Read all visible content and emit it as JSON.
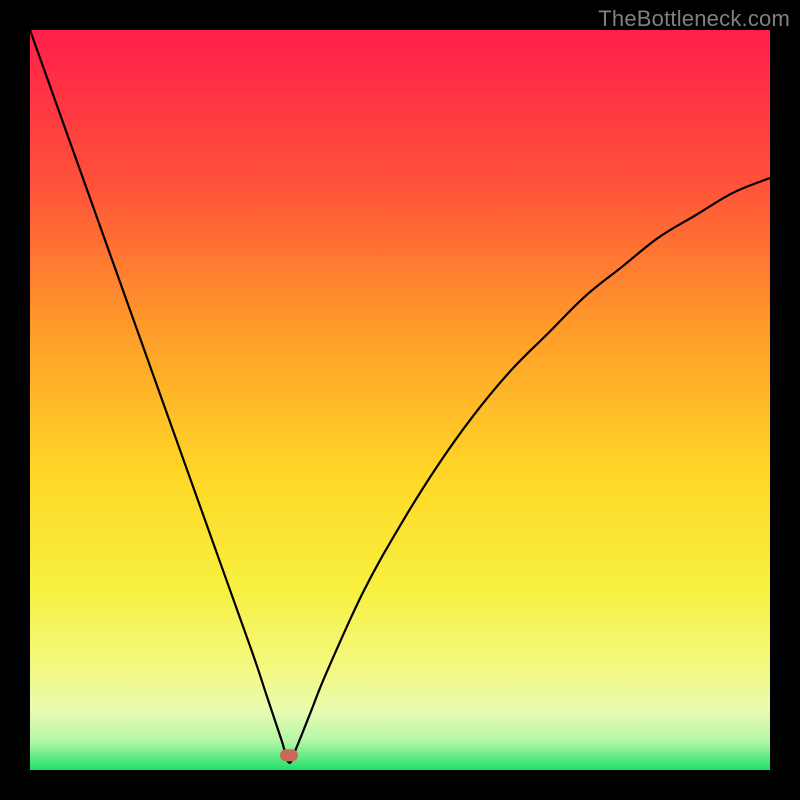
{
  "watermark": "TheBottleneck.com",
  "chart_data": {
    "type": "line",
    "title": "",
    "xlabel": "",
    "ylabel": "",
    "xlim": [
      0,
      100
    ],
    "ylim": [
      0,
      100
    ],
    "notch_x": 35,
    "marker": {
      "x": 35,
      "y": 2,
      "color": "#c76a5a"
    },
    "series": [
      {
        "name": "curve",
        "x": [
          0,
          5,
          10,
          15,
          20,
          25,
          30,
          32,
          34,
          35,
          36,
          38,
          40,
          45,
          50,
          55,
          60,
          65,
          70,
          75,
          80,
          85,
          90,
          95,
          100
        ],
        "y": [
          100,
          86,
          72,
          58,
          44,
          30,
          16,
          10,
          4,
          1,
          3,
          8,
          13,
          24,
          33,
          41,
          48,
          54,
          59,
          64,
          68,
          72,
          75,
          78,
          80
        ]
      }
    ],
    "gradient_stops": [
      {
        "offset": 0,
        "color": "#ff1f4b"
      },
      {
        "offset": 20,
        "color": "#ff4f3a"
      },
      {
        "offset": 40,
        "color": "#ff9a2a"
      },
      {
        "offset": 60,
        "color": "#ffd726"
      },
      {
        "offset": 75,
        "color": "#f8ef3e"
      },
      {
        "offset": 86,
        "color": "#f3f97f"
      },
      {
        "offset": 92,
        "color": "#e9fbb0"
      },
      {
        "offset": 96,
        "color": "#b6f7a8"
      },
      {
        "offset": 100,
        "color": "#21e06a"
      }
    ]
  }
}
